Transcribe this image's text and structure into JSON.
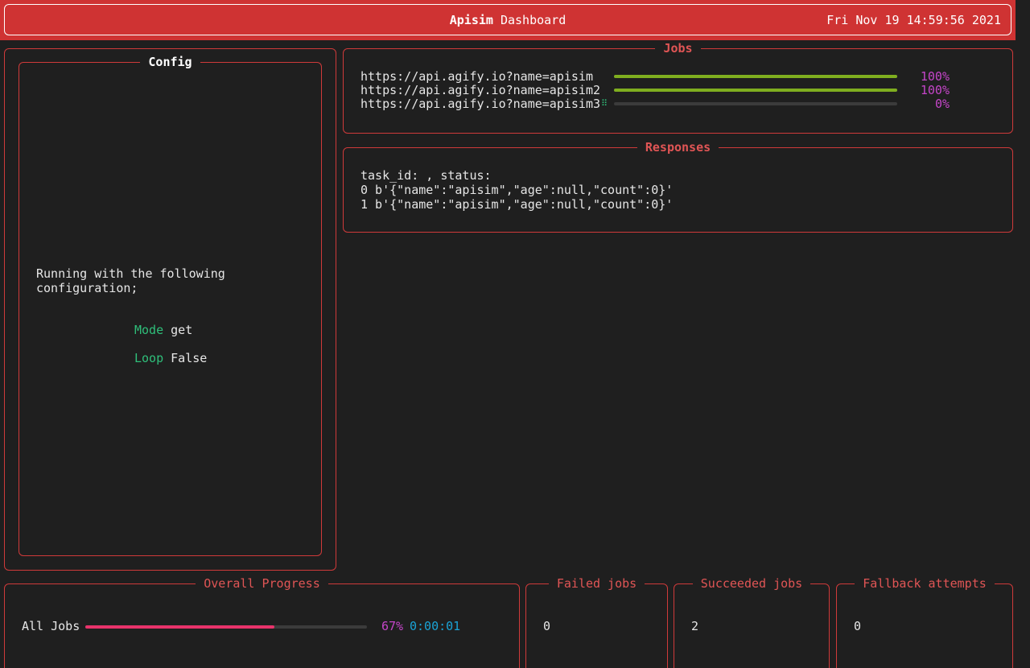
{
  "header": {
    "title_bold": "Apisim",
    "title_rest": " Dashboard",
    "clock": "Fri Nov 19 14:59:56 2021"
  },
  "config": {
    "title": "Config",
    "text_line1": "Running with the following",
    "text_line2": "configuration;",
    "mode_key": "Mode",
    "mode_value": "get",
    "loop_key": "Loop",
    "loop_value": "False"
  },
  "jobs": {
    "title": "Jobs",
    "items": [
      {
        "url": "https://api.agify.io?name=apisim",
        "percent_label": "100%",
        "progress": 1.0,
        "spinner": ""
      },
      {
        "url": "https://api.agify.io?name=apisim2",
        "percent_label": "100%",
        "progress": 1.0,
        "spinner": ""
      },
      {
        "url": "https://api.agify.io?name=apisim3",
        "percent_label": "0%",
        "progress": 0.0,
        "spinner": "⠿"
      }
    ]
  },
  "responses": {
    "title": "Responses",
    "lines": [
      "task_id: , status:",
      "0 b'{\"name\":\"apisim\",\"age\":null,\"count\":0}'",
      "1 b'{\"name\":\"apisim\",\"age\":null,\"count\":0}'"
    ]
  },
  "overall": {
    "title": "Overall Progress",
    "label": "All Jobs",
    "percent_label": "67%",
    "progress": 0.67,
    "elapsed": "0:00:01"
  },
  "stats": {
    "failed_title": "Failed jobs",
    "failed_value": "0",
    "succeeded_title": "Succeeded jobs",
    "succeeded_value": "2",
    "fallback_title": "Fallback attempts",
    "fallback_value": "0"
  },
  "colors": {
    "accent": "#cf3333",
    "job_bar": "#7fae1f",
    "overall_bar": "#e8336b",
    "percent": "#c545c9",
    "time": "#1aa3d6",
    "config_key": "#2fbf7a"
  }
}
